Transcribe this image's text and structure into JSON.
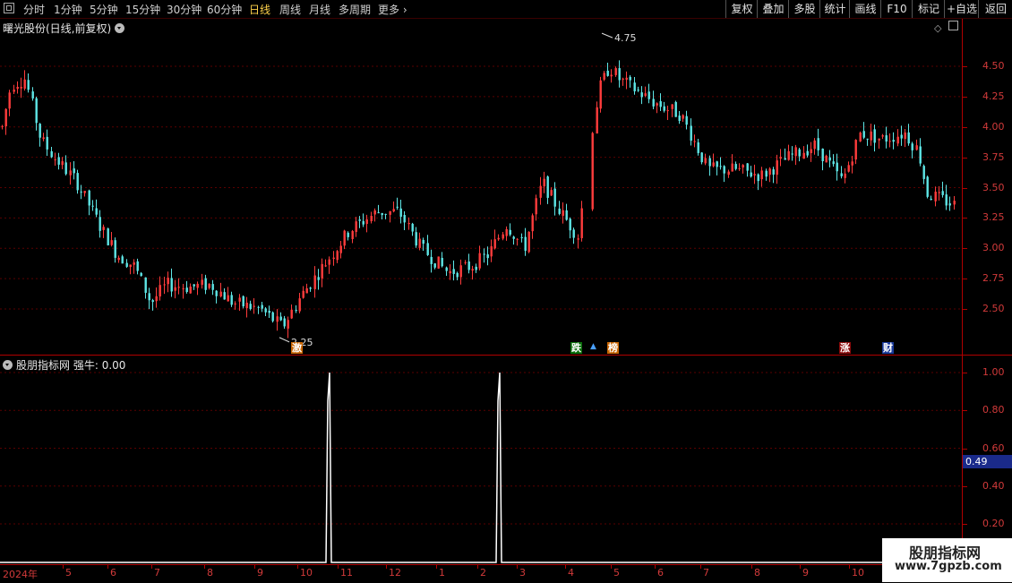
{
  "toolbar": {
    "periods": [
      "分时",
      "1分钟",
      "5分钟",
      "15分钟",
      "30分钟",
      "60分钟",
      "日线",
      "周线",
      "月线",
      "多周期",
      "更多"
    ],
    "active_period": "日线",
    "right_tabs": [
      "复权",
      "叠加",
      "多股",
      "统计",
      "画线",
      "F10",
      "标记",
      "+自选",
      "返回"
    ]
  },
  "main_panel": {
    "title": "曙光股份(日线,前复权)",
    "y_ticks": [
      "4.50",
      "4.25",
      "4.00",
      "3.75",
      "3.50",
      "3.25",
      "3.00",
      "2.75",
      "2.50"
    ],
    "annotations": {
      "high": "4.75",
      "low": "2.25"
    },
    "event_marks": [
      {
        "text": "激",
        "bg": "#c86400",
        "fg": "#ffffff"
      },
      {
        "text": "跌",
        "bg": "#0a6e0a",
        "fg": "#ffffff"
      },
      {
        "text": "榜",
        "bg": "#c86400",
        "fg": "#ffffff"
      },
      {
        "text": "涨",
        "bg": "#8a0a0a",
        "fg": "#ffffff"
      },
      {
        "text": "财",
        "bg": "#1a3a9a",
        "fg": "#ffffff"
      }
    ]
  },
  "indicator_panel": {
    "title": "股朋指标网",
    "series_label": "强牛",
    "series_value": "0.00",
    "y_ticks": [
      "1.00",
      "0.80",
      "0.60",
      "0.40",
      "0.20"
    ],
    "current_value": "0.49"
  },
  "x_axis": {
    "labels": [
      "2024年",
      "5",
      "6",
      "7",
      "8",
      "9",
      "10",
      "11",
      "12",
      "1",
      "2",
      "3",
      "4",
      "5",
      "6",
      "7",
      "8",
      "9",
      "10"
    ]
  },
  "watermark": {
    "line1": "股朋指标网",
    "line2": "www.7gpzb.com"
  },
  "colors": {
    "up": "#ff3c3c",
    "down": "#5ee6e6",
    "axis": "#b00000",
    "grid": "#5a0000",
    "active": "#ffd24a"
  },
  "chart_data": [
    {
      "type": "candlestick",
      "title": "曙光股份(日线,前复权)",
      "ylim": [
        2.2,
        4.85
      ],
      "y_ticks": [
        4.5,
        4.25,
        4.0,
        3.75,
        3.5,
        3.25,
        3.0,
        2.75,
        2.5
      ],
      "x_months": [
        "2024年",
        "5",
        "6",
        "7",
        "8",
        "9",
        "10",
        "11",
        "12",
        "1",
        "2",
        "3",
        "4",
        "5",
        "6",
        "7",
        "8",
        "9",
        "10"
      ],
      "close_by_month": [
        4.3,
        3.6,
        3.1,
        2.6,
        2.7,
        2.5,
        2.4,
        3.4,
        3.2,
        2.8,
        3.0,
        3.5,
        3.3,
        4.4,
        4.1,
        3.6,
        3.6,
        3.8,
        3.9,
        3.35
      ],
      "max_label": 4.75,
      "min_label": 2.25
    },
    {
      "type": "line",
      "title": "强牛",
      "ylim": [
        0.0,
        1.05
      ],
      "y_ticks": [
        1.0,
        0.8,
        0.6,
        0.4,
        0.2
      ],
      "spikes": [
        {
          "month": "10/11",
          "value": 1.0
        },
        {
          "month": "2/3",
          "value": 1.0
        }
      ],
      "baseline": 0.0,
      "current_value": 0.49
    }
  ]
}
